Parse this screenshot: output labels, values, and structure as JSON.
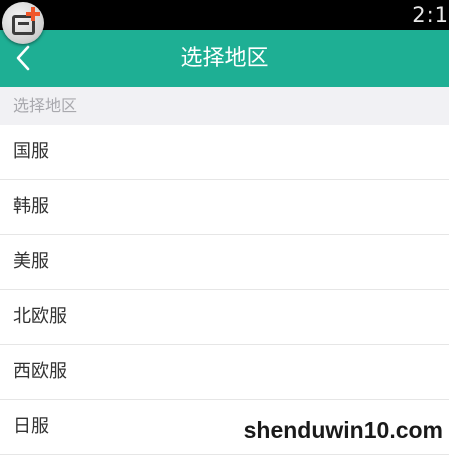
{
  "status_bar": {
    "time": "2:1"
  },
  "app_badge": {
    "icon": "add-window-icon",
    "accent": "#f0572a"
  },
  "nav": {
    "back_icon": "chevron-left-icon",
    "title": "选择地区",
    "color": "#1eaf94"
  },
  "section": {
    "header": "选择地区"
  },
  "regions": [
    {
      "label": "国服"
    },
    {
      "label": "韩服"
    },
    {
      "label": "美服"
    },
    {
      "label": "北欧服"
    },
    {
      "label": "西欧服"
    },
    {
      "label": "日服"
    }
  ],
  "watermark": {
    "text": "shenduwin10.com"
  }
}
